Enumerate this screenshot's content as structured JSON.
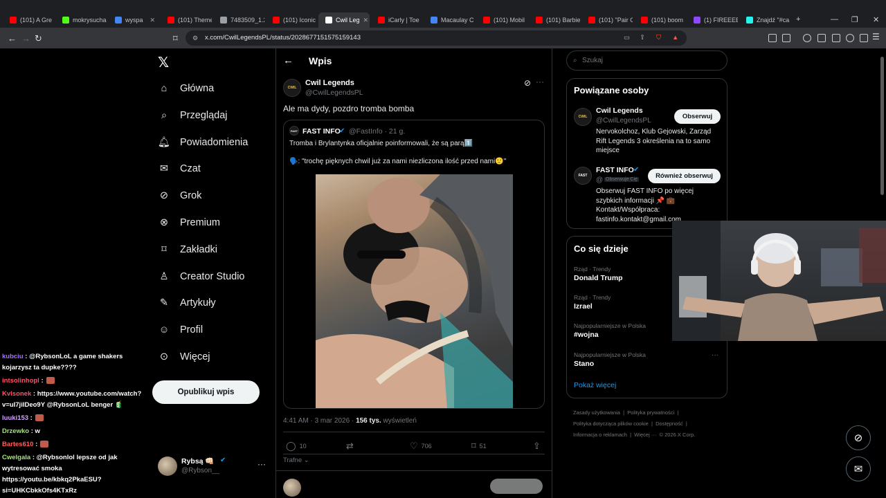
{
  "browser": {
    "tabs": [
      {
        "label": "(101) A Gre",
        "color": "#ff0000"
      },
      {
        "label": "mokrysucha",
        "color": "#53fc18"
      },
      {
        "label": "wyspa",
        "color": "#4285f4"
      },
      {
        "label": "(101) Theme",
        "color": "#ff0000"
      },
      {
        "label": "7483509_1.2",
        "color": "#9aa0a6"
      },
      {
        "label": "(101) Iconic",
        "color": "#ff0000"
      },
      {
        "label": "Cwil Leg",
        "color": "#ffffff"
      },
      {
        "label": "iCarly | Toe",
        "color": "#ff0000"
      },
      {
        "label": "Macaulay C",
        "color": "#4285f4"
      },
      {
        "label": "(101) Mobil",
        "color": "#ff0000"
      },
      {
        "label": "(101) Barbie",
        "color": "#ff0000"
      },
      {
        "label": "(101) \"Pair C",
        "color": "#ff0000"
      },
      {
        "label": "(101) boom",
        "color": "#ff0000"
      },
      {
        "label": "(1) FIREEEE",
        "color": "#9146ff"
      },
      {
        "label": "Znajdź \"#ca",
        "color": "#25f4ee"
      }
    ],
    "url": "x.com/CwilLegendsPL/status/2028677151575159143"
  },
  "nav": {
    "items": [
      "Główna",
      "Przeglądaj",
      "Powiadomienia",
      "Czat",
      "Grok",
      "Premium",
      "Zakładki",
      "Creator Studio",
      "Artykuły",
      "Profil",
      "Więcej"
    ],
    "post_button": "Opublikuj wpis",
    "user": {
      "name": "Rybsą 👊🏻",
      "handle": "@Rybson__"
    }
  },
  "chat": [
    {
      "user": "kubciu",
      "text": ": @RybsonLoL a game shakers kojarzysz ta dupke????"
    },
    {
      "user": "intsolinhopl",
      "text": ":"
    },
    {
      "user": "Kvlsonek",
      "text": ": https://www.youtube.com/watch?v=uI7jiIDeo9Y @RybsonLoL benger 🧃"
    },
    {
      "user": "luuki153",
      "text": ":"
    },
    {
      "user": "Drzewko",
      "text": ": w"
    },
    {
      "user": "Bartes610",
      "text": ":"
    },
    {
      "user": "Cwelgala",
      "text": ": @Rybsonlol lepsze od jak wytresować smoka https://youtu.be/kbkq2PkaESU?si=UHKCbkkOfs4KTxRz"
    }
  ],
  "post": {
    "header_title": "Wpis",
    "author": {
      "name": "Cwil Legends",
      "handle": "@CwilLegendsPL"
    },
    "text": "Ale ma dydy, pozdro tromba bomba",
    "quote": {
      "name": "FAST INFO",
      "handle": "@FastInfo · 21 g.",
      "line1": "Tromba i Brylantynka oficjalnie poinformowali, że są parą1️⃣",
      "line2": "🗣️: \"trochę pięknych chwil już za nami niezliczona ilość przed nami🙂\""
    },
    "timestamp": "4:41 AM · 3 mar 2026 · ",
    "views": "156 tys.",
    "views_label": " wyświetleń",
    "stats": {
      "replies": "10",
      "likes": "706",
      "bookmarks": "51"
    },
    "sort_label": "Trafne"
  },
  "right": {
    "search_placeholder": "Szukaj",
    "related_title": "Powiązane osoby",
    "people": [
      {
        "name": "Cwil Legends",
        "handle": "@CwilLegendsPL",
        "button": "Obserwuj",
        "bio": "Nervokolchoz, Klub Gejowski, Zarząd Rift Legends 3 określenia na to samo miejsce"
      },
      {
        "name": "FAST INFO",
        "handle": "@",
        "badge": "Obserwuje Cię",
        "button": "Również obserwuj",
        "bio": "Obserwuj FAST INFO po więcej szybkich informacji 📌 💼 Kontakt/Współpraca: fastinfo.kontakt@gmail.com"
      }
    ],
    "trends_title": "Co się dzieje",
    "trends": [
      {
        "category": "Rząd · Trendy",
        "name": "Donald Trump"
      },
      {
        "category": "Rząd · Trendy",
        "name": "Izrael"
      },
      {
        "category": "Najpopularniejsze w Polska",
        "name": "#wojna"
      },
      {
        "category": "Najpopularniejsze w Polska",
        "name": "Stano"
      }
    ],
    "show_more": "Pokaż więcej",
    "footer": [
      "Zasady użytkowania",
      "Polityka prywatności",
      "Polityka dotycząca plików cookie",
      "Dostępność",
      "Informacja o reklamach",
      "Więcej ···",
      "© 2026 X Corp."
    ]
  },
  "colors": {
    "accent": "#1d9bf0",
    "background": "#000000",
    "border": "#2f3336",
    "muted": "#71767b"
  }
}
